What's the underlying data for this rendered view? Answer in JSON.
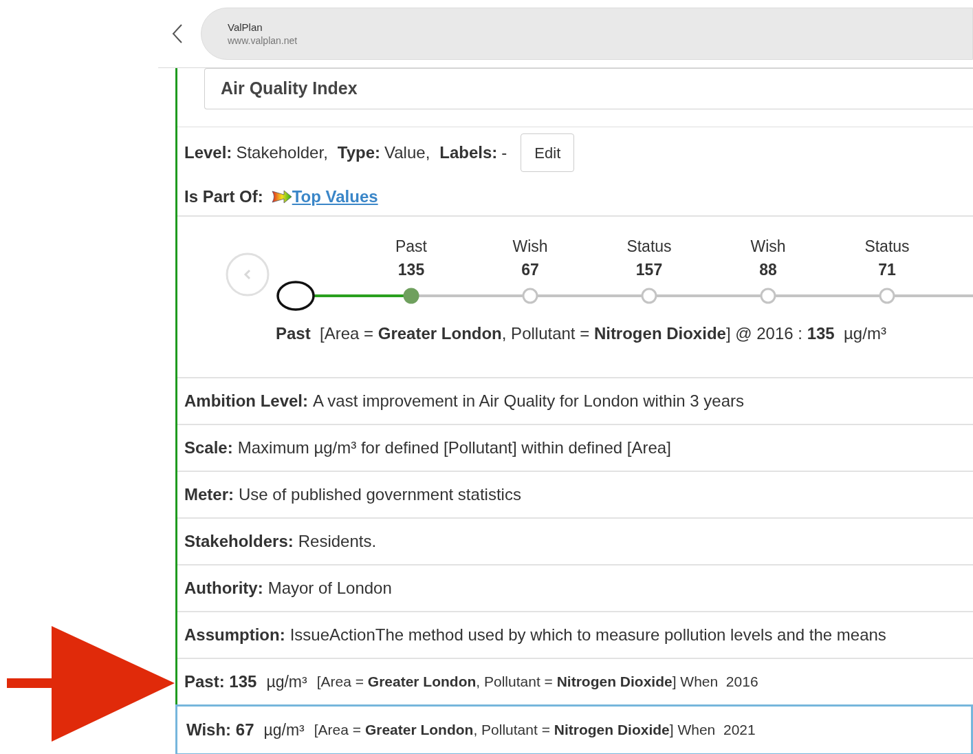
{
  "browser": {
    "site_name": "ValPlan",
    "url": "www.valplan.net"
  },
  "title": "Air Quality Index",
  "meta": [
    {
      "label": "Level:",
      "value": "Stakeholder,"
    },
    {
      "label": "Type:",
      "value": "Value,"
    },
    {
      "label": "Labels:",
      "value": "-"
    }
  ],
  "edit_button": "Edit",
  "part_of": {
    "label": "Is Part Of:",
    "link": "Top Values"
  },
  "timeline": {
    "points": [
      {
        "label": "Past",
        "value": "135",
        "selected": true
      },
      {
        "label": "Wish",
        "value": "67",
        "selected": false
      },
      {
        "label": "Status",
        "value": "157",
        "selected": false
      },
      {
        "label": "Wish",
        "value": "88",
        "selected": false
      },
      {
        "label": "Status",
        "value": "71",
        "selected": false
      }
    ],
    "detail": "**Past**  [Area = **Greater London**, Pollutant = **Nitrogen Dioxide**] @ 2016 : **135**  µg/m³"
  },
  "fields": [
    {
      "label": "Ambition Level:",
      "value": "A vast improvement in Air Quality for London within 3 years"
    },
    {
      "label": "Scale:",
      "value": "Maximum µg/m³ for defined [Pollutant] within defined [Area]"
    },
    {
      "label": "Meter:",
      "value": "Use of published government statistics"
    },
    {
      "label": "Stakeholders:",
      "value": "Residents."
    },
    {
      "label": "Authority:",
      "value": "Mayor of London"
    },
    {
      "label": "Assumption:",
      "value": "IssueActionThe method used by which to measure pollution levels and the means"
    }
  ],
  "values": [
    {
      "head": "Past: 135",
      "unit": "µg/m³",
      "detail": "[Area = **Greater London**, Pollutant = **Nitrogen Dioxide**] When  2016",
      "selected": false
    },
    {
      "head": "Wish: 67",
      "unit": "µg/m³",
      "detail": "[Area = **Greater London**, Pollutant = **Nitrogen Dioxide**] When  2021",
      "selected": true
    }
  ]
}
